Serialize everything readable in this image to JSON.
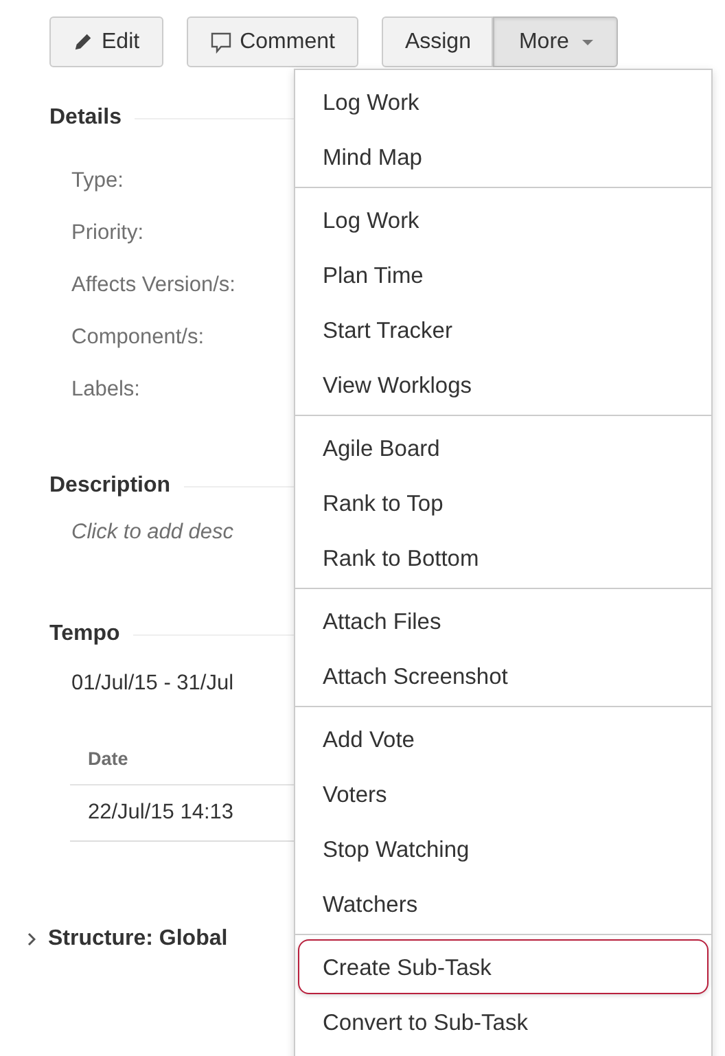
{
  "toolbar": [
    {
      "kind": "edit",
      "label": "Edit",
      "pressed": false
    },
    {
      "kind": "comment",
      "label": "Comment",
      "pressed": false
    },
    {
      "kind": "plain",
      "label": "Assign",
      "pressed": false
    },
    {
      "kind": "dropdown",
      "label": "More",
      "pressed": true
    }
  ],
  "details": {
    "heading": "Details",
    "fields": [
      "Type:",
      "Priority:",
      "Affects Version/s:",
      "Component/s:",
      "Labels:"
    ]
  },
  "description": {
    "heading": "Description",
    "placeholder": "Click to add desc"
  },
  "tempo": {
    "heading": "Tempo",
    "period": "01/Jul/15 - 31/Jul",
    "table": {
      "columns": [
        "Date"
      ],
      "rows": [
        [
          "22/Jul/15 14:13"
        ]
      ]
    }
  },
  "structure": {
    "label": "Structure: Global",
    "expanded": false
  },
  "more_menu": [
    [
      {
        "label": "Log Work",
        "selected": false
      },
      {
        "label": "Mind Map",
        "selected": false
      }
    ],
    [
      {
        "label": "Log Work",
        "selected": false
      },
      {
        "label": "Plan Time",
        "selected": false
      },
      {
        "label": "Start Tracker",
        "selected": false
      },
      {
        "label": "View Worklogs",
        "selected": false
      }
    ],
    [
      {
        "label": "Agile Board",
        "selected": false
      },
      {
        "label": "Rank to Top",
        "selected": false
      },
      {
        "label": "Rank to Bottom",
        "selected": false
      }
    ],
    [
      {
        "label": "Attach Files",
        "selected": false
      },
      {
        "label": "Attach Screenshot",
        "selected": false
      }
    ],
    [
      {
        "label": "Add Vote",
        "selected": false
      },
      {
        "label": "Voters",
        "selected": false
      },
      {
        "label": "Stop Watching",
        "selected": false
      },
      {
        "label": "Watchers",
        "selected": false
      }
    ],
    [
      {
        "label": "Create Sub-Task",
        "selected": true
      },
      {
        "label": "Convert to Sub-Task",
        "selected": false
      }
    ]
  ]
}
